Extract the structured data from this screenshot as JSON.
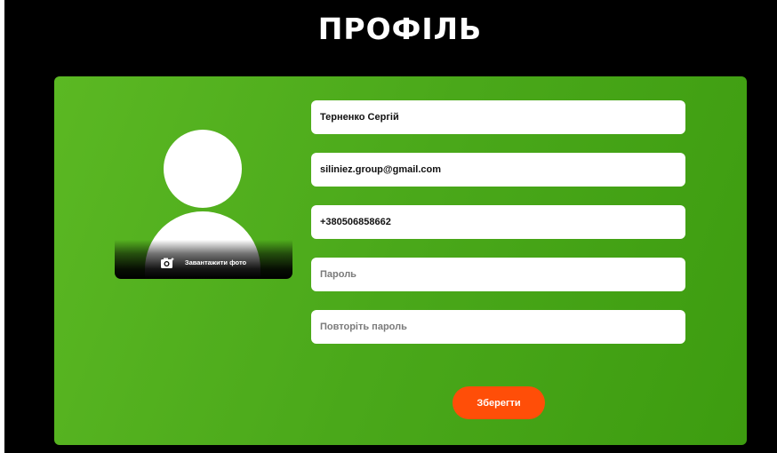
{
  "page": {
    "title": "ПРОФІЛЬ"
  },
  "avatar": {
    "upload_label": "Завантажити фото",
    "upload_icon": "camera-icon"
  },
  "form": {
    "name": {
      "value": "Терненко Сергій",
      "placeholder": ""
    },
    "email": {
      "value": "siliniez.group@gmail.com",
      "placeholder": ""
    },
    "phone": {
      "value": "+380506858662",
      "placeholder": ""
    },
    "password": {
      "value": "",
      "placeholder": "Пароль"
    },
    "password_repeat": {
      "value": "",
      "placeholder": "Повторіть пароль"
    },
    "save_label": "Зберегти"
  },
  "colors": {
    "background": "#000000",
    "card_green": "#4aa81a",
    "save_button": "#ff4e08",
    "field_background": "#ffffff"
  }
}
